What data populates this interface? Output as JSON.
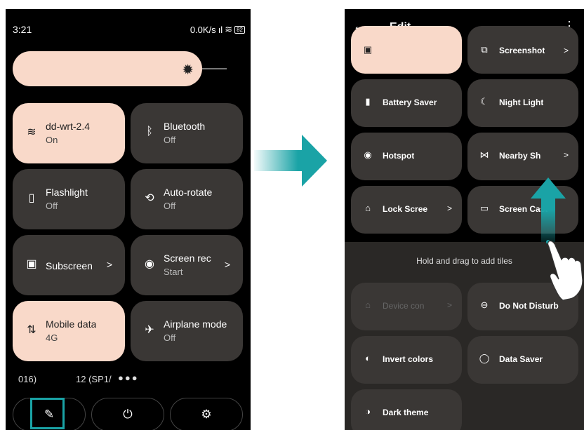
{
  "left_screen": {
    "status": {
      "time": "3:21",
      "net": "0.0K/s",
      "battery": "82"
    },
    "tiles": [
      {
        "label": "dd-wrt-2.4",
        "sub": "On",
        "icon": "wifi-icon",
        "on": true
      },
      {
        "label": "Bluetooth",
        "sub": "Off",
        "icon": "bluetooth-icon",
        "on": false
      },
      {
        "label": "Flashlight",
        "sub": "Off",
        "icon": "flashlight-icon",
        "on": false
      },
      {
        "label": "Auto-rotate",
        "sub": "Off",
        "icon": "rotate-icon",
        "on": false
      },
      {
        "label": "Subscreen",
        "sub": "",
        "icon": "subscreen-icon",
        "on": false,
        "chevron": ">"
      },
      {
        "label": "Screen rec",
        "sub": "Start",
        "icon": "record-icon",
        "on": false,
        "chevron": ">"
      },
      {
        "label": "Mobile data",
        "sub": "4G",
        "icon": "mobile-data-icon",
        "on": true
      },
      {
        "label": "Airplane mode",
        "sub": "Off",
        "icon": "airplane-icon",
        "on": false
      }
    ],
    "footer": {
      "build_left": "016)",
      "build_right": "12 (SP1/",
      "dots": "●●●"
    }
  },
  "right_screen": {
    "title": "Edit",
    "active_tiles": [
      {
        "label": "",
        "icon": "screen-icon"
      },
      {
        "label": "Screenshot",
        "icon": "screenshot-icon",
        "chevron": ">"
      },
      {
        "label": "Battery Saver",
        "icon": "battery-icon"
      },
      {
        "label": "Night Light",
        "icon": "moon-icon"
      },
      {
        "label": "Hotspot",
        "icon": "hotspot-icon"
      },
      {
        "label": "Nearby Sh",
        "icon": "nearby-icon",
        "chevron": ">"
      },
      {
        "label": "Lock Scree",
        "icon": "lock-icon",
        "chevron": ">"
      },
      {
        "label": "Screen Cast",
        "icon": "cast-icon"
      }
    ],
    "tray_message": "Hold and drag to add tiles",
    "available_tiles": [
      {
        "label": "Device con",
        "icon": "home-icon",
        "chevron": ">"
      },
      {
        "label": "Do Not Disturb",
        "icon": "dnd-icon"
      },
      {
        "label": "Invert colors",
        "icon": "invert-icon"
      },
      {
        "label": "Data Saver",
        "icon": "data-saver-icon"
      },
      {
        "label": "Dark theme",
        "icon": "dark-theme-icon"
      }
    ]
  },
  "colors": {
    "accent": "#1aa3a6",
    "tile_on": "#f9d9c9",
    "tile_off": "#3a3735"
  }
}
